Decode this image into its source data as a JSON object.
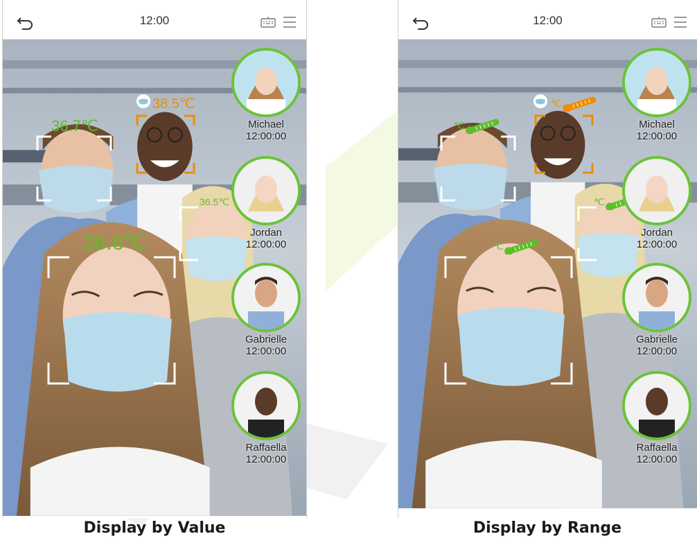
{
  "colors": {
    "normal": "#5cbf2a",
    "alert": "#f08c00",
    "ring": "#6cc23a"
  },
  "left": {
    "status": {
      "time": "12:00",
      "icons": [
        "back-arrow-icon",
        "keyboard-icon",
        "menu-icon"
      ]
    },
    "temperatures": {
      "man_left": "36.7℃",
      "man_alert": "38.5℃",
      "woman_front": "36.6℃",
      "woman_right": "36.5℃"
    },
    "records": [
      {
        "name": "Michael",
        "time": "12:00:00"
      },
      {
        "name": "Jordan",
        "time": "12:00:00"
      },
      {
        "name": "Gabrielle",
        "time": "12:00:00"
      },
      {
        "name": "Raffaella",
        "time": "12:00:00"
      }
    ],
    "caption": "Display by Value"
  },
  "right": {
    "status": {
      "time": "12:00",
      "icons": [
        "back-arrow-icon",
        "keyboard-icon",
        "menu-icon"
      ]
    },
    "thermo_unit": "℃",
    "records": [
      {
        "name": "Michael",
        "time": "12:00:00"
      },
      {
        "name": "Jordan",
        "time": "12:00:00"
      },
      {
        "name": "Gabrielle",
        "time": "12:00:00"
      },
      {
        "name": "Raffaella",
        "time": "12:00:00"
      }
    ],
    "caption": "Display by Range"
  }
}
